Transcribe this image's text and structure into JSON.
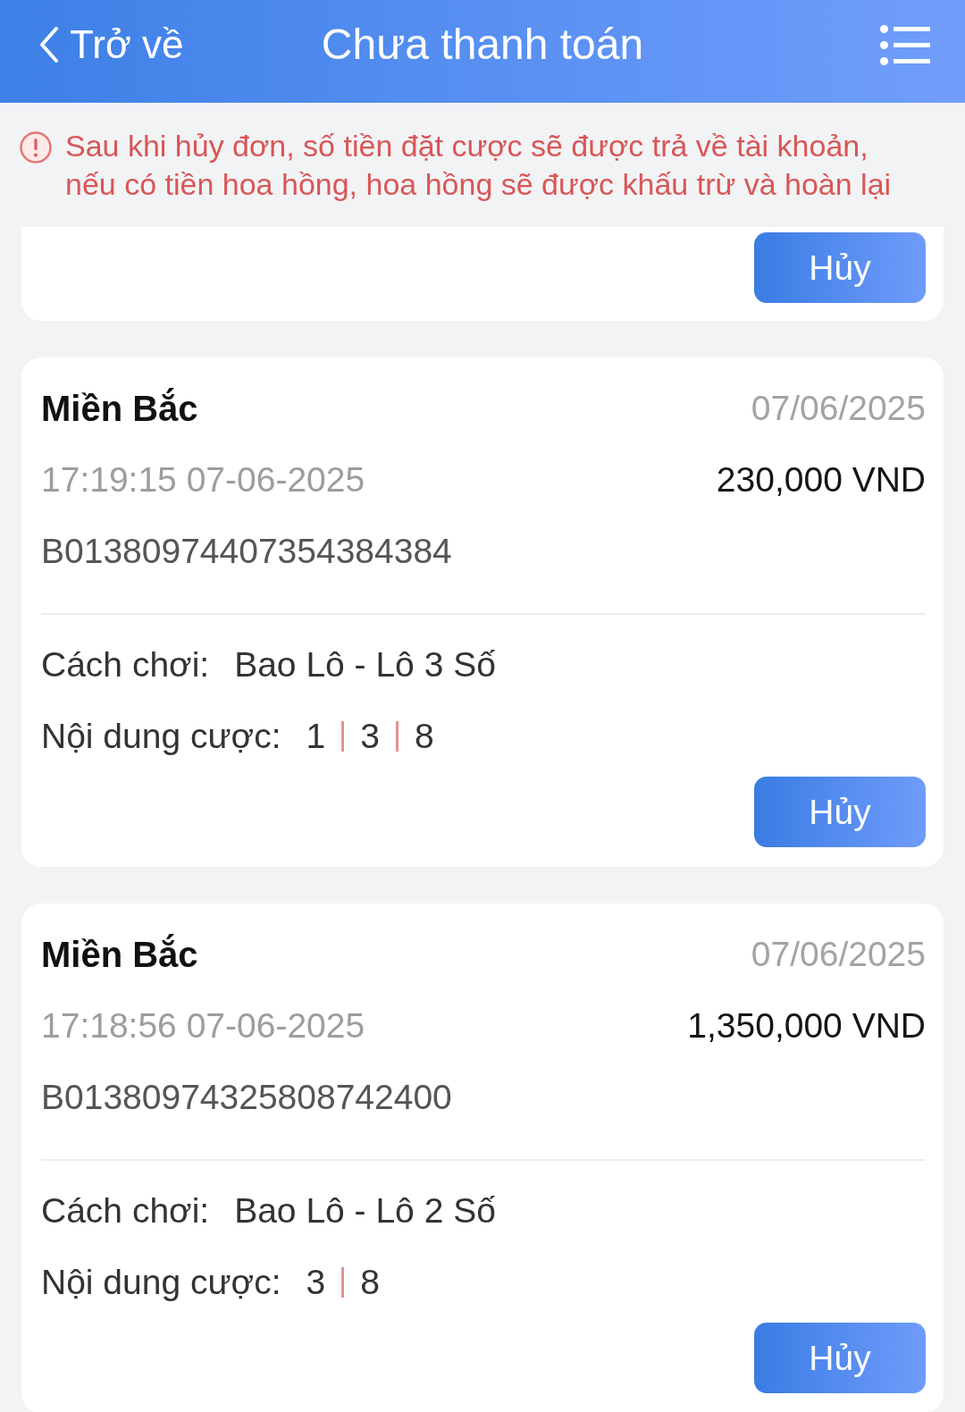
{
  "header": {
    "back_label": "Trở về",
    "title": "Chưa thanh toán"
  },
  "notice": {
    "text": "Sau khi hủy đơn, số tiền đặt cược sẽ được trả về tài khoản, nếu có tiền hoa hồng, hoa hồng sẽ được khấu trừ và hoàn lại"
  },
  "orders": [
    {
      "kind": "partial",
      "cancel_label": "Hủy"
    },
    {
      "kind": "full",
      "region": "Miền Bắc",
      "date": "07/06/2025",
      "time": "17:19:15 07-06-2025",
      "amount": "230,000 VND",
      "order_id": "B01380974407354384384",
      "play_label": "Cách chơi:",
      "play_type": "Bao Lô - Lô 3 Số",
      "content_label": "Nội dung cược:",
      "bet_numbers": [
        "1",
        "3",
        "8"
      ],
      "cancel_label": "Hủy"
    },
    {
      "kind": "full",
      "region": "Miền Bắc",
      "date": "07/06/2025",
      "time": "17:18:56 07-06-2025",
      "amount": "1,350,000 VND",
      "order_id": "B01380974325808742400",
      "play_label": "Cách chơi:",
      "play_type": "Bao Lô - Lô 2 Số",
      "content_label": "Nội dung cược:",
      "bet_numbers": [
        "3",
        "8"
      ],
      "cancel_label": "Hủy"
    }
  ]
}
